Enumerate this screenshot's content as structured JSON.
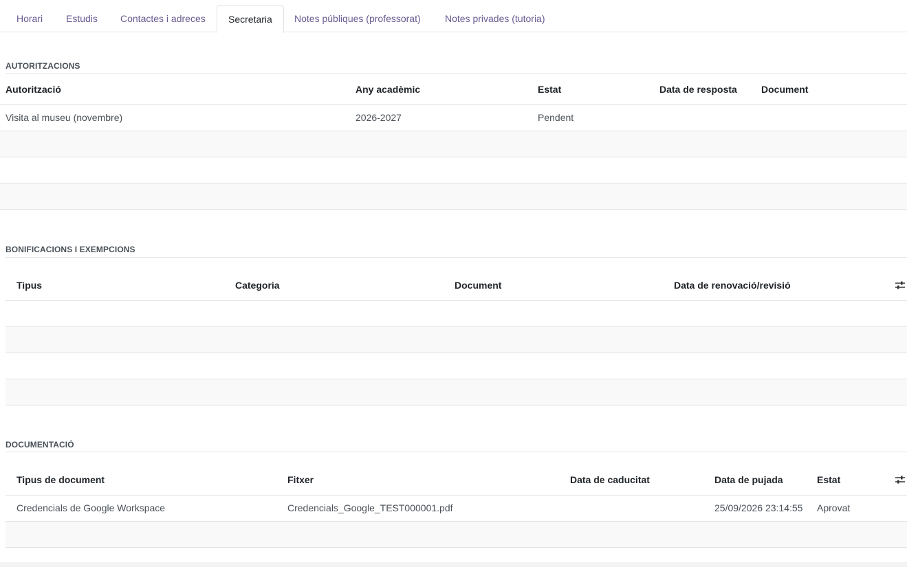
{
  "tabs": [
    {
      "label": "Horari"
    },
    {
      "label": "Estudis"
    },
    {
      "label": "Contactes i adreces"
    },
    {
      "label": "Secretaria",
      "active": true
    },
    {
      "label": "Notes públiques (professorat)"
    },
    {
      "label": "Notes privades (tutoria)"
    }
  ],
  "authorizations": {
    "title": "AUTORITZACIONS",
    "columns": [
      "Autorització",
      "Any acadèmic",
      "Estat",
      "Data de resposta",
      "Document"
    ],
    "rows": [
      {
        "name": "Visita al museu (novembre)",
        "year": "2026-2027",
        "status": "Pendent",
        "response_date": "",
        "document": ""
      }
    ]
  },
  "bonuses": {
    "title": "BONIFICACIONS I EXEMPCIONS",
    "columns": [
      "Tipus",
      "Categoria",
      "Document",
      "Data de renovació/revisió"
    ],
    "settings_icon": "sliders-icon"
  },
  "documents": {
    "title": "DOCUMENTACIÓ",
    "columns": [
      "Tipus de document",
      "Fitxer",
      "Data de caducitat",
      "Data de pujada",
      "Estat"
    ],
    "rows": [
      {
        "type": "Credencials de Google Workspace",
        "file": "Credencials_Google_TEST000001.pdf",
        "expiry": "",
        "uploaded": "25/09/2026 23:14:55",
        "status": "Aprovat"
      }
    ],
    "settings_icon": "sliders-icon"
  },
  "colors": {
    "tab_link": "#6a5a91",
    "pending": "#9a7b12",
    "approved": "#1e8c2e"
  }
}
